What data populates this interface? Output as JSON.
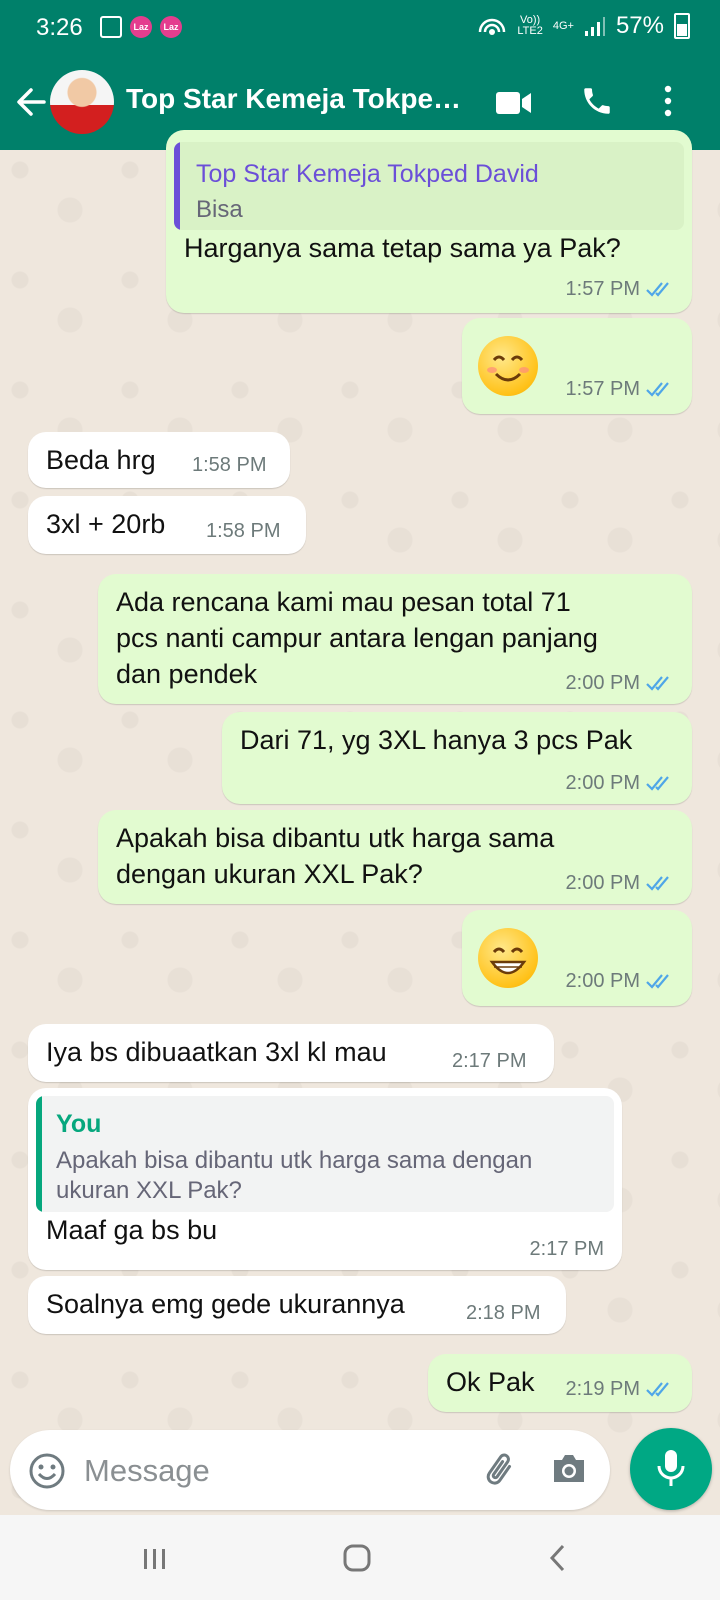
{
  "status_bar": {
    "time": "3:26",
    "network_top": "Vo))",
    "network_bottom": "LTE2",
    "network_type": "4G+",
    "battery": "57%"
  },
  "header": {
    "contact_name": "Top Star Kemeja Tokped David"
  },
  "messages": [
    {
      "id": "m1",
      "direction": "out",
      "quote_author": "Top Star Kemeja Tokped David",
      "quote_text": "Bisa",
      "text": "Harganya sama tetap sama ya Pak?",
      "time": "1:57 PM"
    },
    {
      "id": "m2",
      "direction": "out",
      "emoji": "smiling-face-icon",
      "time": "1:57 PM"
    },
    {
      "id": "m3",
      "direction": "in",
      "text": "Beda hrg",
      "time": "1:58 PM"
    },
    {
      "id": "m4",
      "direction": "in",
      "text": "3xl + 20rb",
      "time": "1:58 PM"
    },
    {
      "id": "m5",
      "direction": "out",
      "lines": [
        "Ada rencana kami mau pesan total 71",
        "pcs nanti campur antara lengan panjang",
        "dan pendek"
      ],
      "time": "2:00 PM"
    },
    {
      "id": "m6",
      "direction": "out",
      "text": "Dari 71, yg 3XL hanya 3 pcs Pak",
      "time": "2:00 PM"
    },
    {
      "id": "m7",
      "direction": "out",
      "lines": [
        "Apakah bisa dibantu utk harga sama",
        "dengan ukuran XXL Pak?"
      ],
      "time": "2:00 PM"
    },
    {
      "id": "m8",
      "direction": "out",
      "emoji": "grinning-face-icon",
      "time": "2:00 PM"
    },
    {
      "id": "m9",
      "direction": "in",
      "text": "Iya bs dibuaatkan 3xl kl mau",
      "time": "2:17 PM"
    },
    {
      "id": "m10",
      "direction": "in",
      "quote_author": "You",
      "quote_lines": [
        "Apakah bisa dibantu utk harga sama dengan",
        "ukuran XXL Pak?"
      ],
      "text": "Maaf ga bs bu",
      "time": "2:17 PM"
    },
    {
      "id": "m11",
      "direction": "in",
      "text": "Soalnya emg gede ukurannya",
      "time": "2:18 PM"
    },
    {
      "id": "m12",
      "direction": "out",
      "text": "Ok Pak",
      "time": "2:19 PM"
    }
  ],
  "composer": {
    "placeholder": "Message"
  },
  "colors": {
    "header": "#00806a",
    "outgoing_bubble": "#e2fbd0",
    "incoming_bubble": "#ffffff",
    "read_ticks": "#4fa6e8",
    "mic_button": "#00a884",
    "quote_bar_contact": "#6b4fd8",
    "quote_bar_you": "#06a77d"
  }
}
